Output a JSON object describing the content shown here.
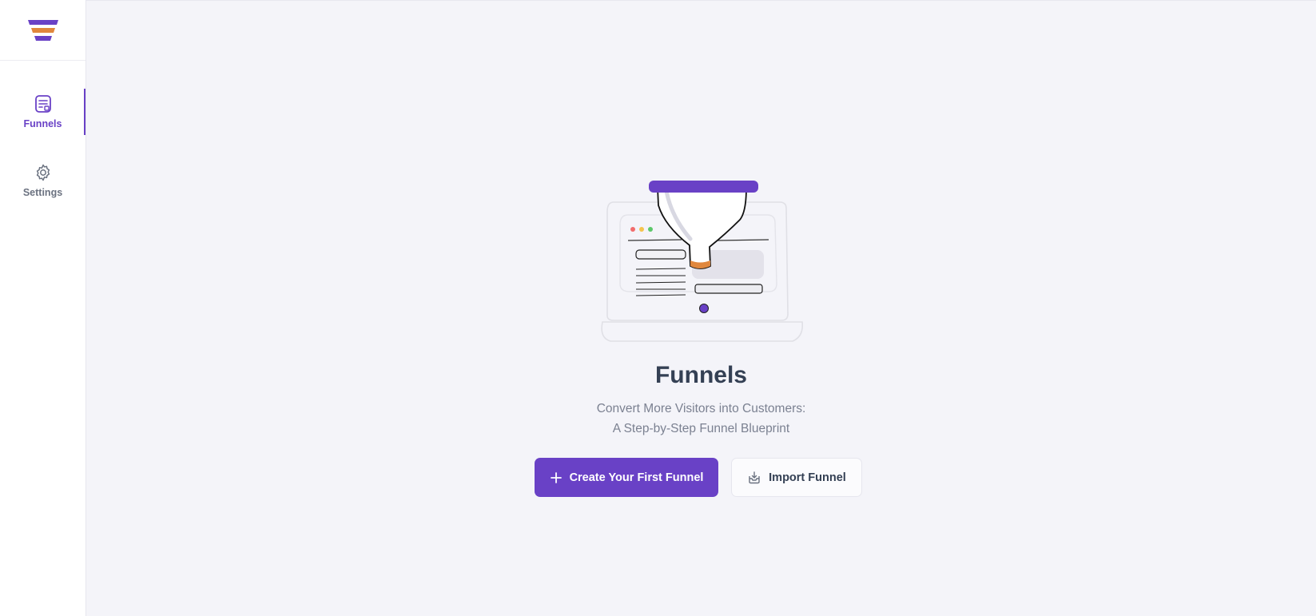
{
  "sidebar": {
    "items": [
      {
        "label": "Funnels",
        "icon": "funnel-document-icon",
        "active": true
      },
      {
        "label": "Settings",
        "icon": "gear-icon",
        "active": false
      }
    ]
  },
  "main": {
    "title": "Funnels",
    "subtitle_line1": "Convert More Visitors into Customers:",
    "subtitle_line2": "A Step-by-Step Funnel Blueprint",
    "primary_button": "Create Your First Funnel",
    "secondary_button": "Import Funnel"
  },
  "colors": {
    "brand": "#6941c6",
    "accent_orange": "#e0873d",
    "title": "#344054",
    "muted": "#7b8191"
  }
}
